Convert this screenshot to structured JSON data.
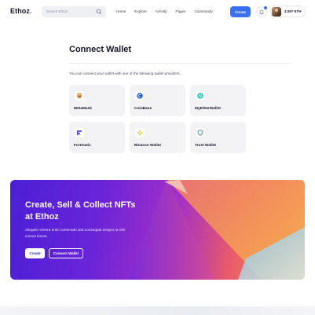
{
  "header": {
    "logo": "Ethoz",
    "logo_dot": ".",
    "search_placeholder": "Search Ethoz",
    "nav": [
      "Home",
      "Explore",
      "Activity",
      "Pages",
      "Community"
    ],
    "create_label": "Create",
    "balance": "3.097 ETH"
  },
  "main": {
    "title": "Connect Wallet",
    "intro": "You can connect your wallet with one of the following wallet providers.",
    "wallets": [
      {
        "label": "MetaMask",
        "icon": "metamask-icon",
        "color": "#e2761b"
      },
      {
        "label": "CoinBase",
        "icon": "coinbase-icon",
        "color": "#0052ff"
      },
      {
        "label": "MyEtherWallet",
        "icon": "myetherwallet-icon",
        "color": "#05c0a5"
      },
      {
        "label": "Fortmatic",
        "icon": "fortmatic-icon",
        "color": "#6851ff"
      },
      {
        "label": "Binance Wallet",
        "icon": "binance-icon",
        "color": "#f0b90b"
      },
      {
        "label": "Trust Wallet",
        "icon": "trust-wallet-icon",
        "color": "#3375bb"
      }
    ]
  },
  "banner": {
    "title": "Create, Sell & Collect NFTs at Ethoz",
    "text": "Aliquam viverra enim commodo sed consequat tempor ut nisi cursus lectus.",
    "create_label": "Create",
    "connect_label": "Connect Wallet"
  },
  "colors": {
    "accent": "#3a6ff8",
    "text": "#14142b"
  }
}
